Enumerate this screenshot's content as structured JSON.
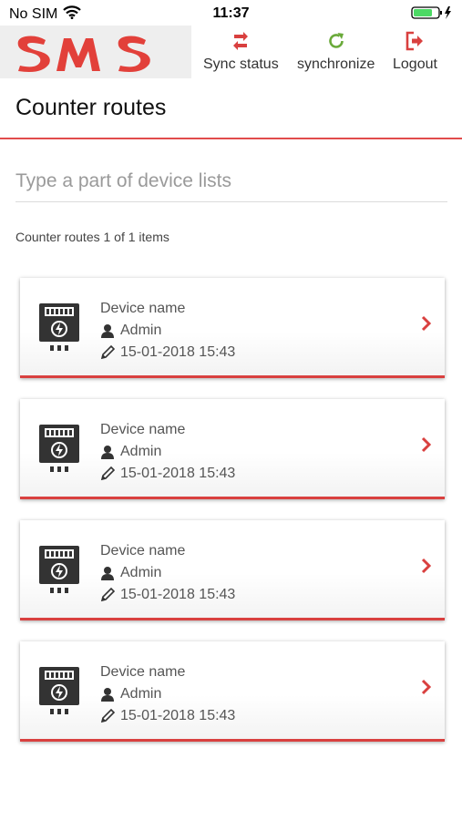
{
  "status_bar": {
    "carrier": "No SIM",
    "time": "11:37"
  },
  "header": {
    "logo_text": "SMS",
    "sync_status_label": "Sync status",
    "synchronize_label": "synchronize",
    "logout_label": "Logout"
  },
  "page": {
    "title": "Counter routes",
    "search_placeholder": "Type a part of device lists",
    "count_text": "Counter routes 1 of 1 items"
  },
  "routes": [
    {
      "name": "Device name",
      "user": "Admin",
      "date": "15-01-2018 15:43"
    },
    {
      "name": "Device name",
      "user": "Admin",
      "date": "15-01-2018 15:43"
    },
    {
      "name": "Device name",
      "user": "Admin",
      "date": "15-01-2018 15:43"
    },
    {
      "name": "Device name",
      "user": "Admin",
      "date": "15-01-2018 15:43"
    }
  ],
  "colors": {
    "accent": "#d9403f",
    "sync_green": "#6aaa3a",
    "text": "#555555"
  },
  "icons": [
    "wifi-icon",
    "battery-icon",
    "sync-status-icon",
    "refresh-icon",
    "logout-icon",
    "meter-device-icon",
    "user-icon",
    "pencil-icon",
    "chevron-right-icon"
  ]
}
